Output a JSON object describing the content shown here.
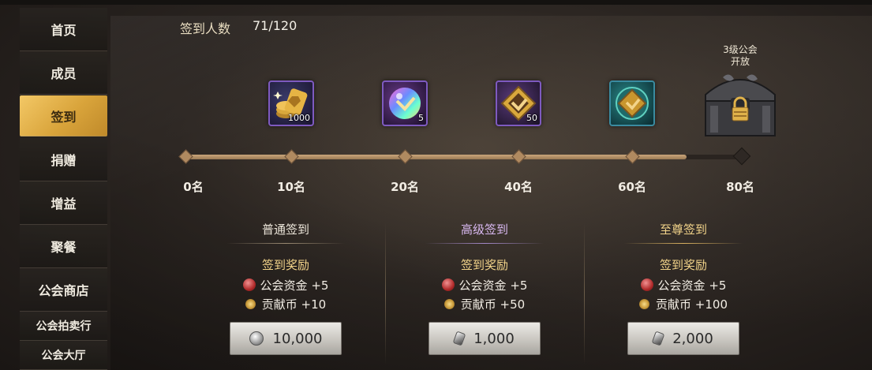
{
  "sidebar": {
    "items": [
      {
        "label": "首页"
      },
      {
        "label": "成员"
      },
      {
        "label": "签到"
      },
      {
        "label": "捐赠"
      },
      {
        "label": "增益"
      },
      {
        "label": "聚餐"
      },
      {
        "label": "公会商店"
      },
      {
        "label": "公会拍卖行"
      },
      {
        "label": "公会大厅"
      }
    ],
    "active_index": 2
  },
  "header": {
    "checkin_label": "签到人数",
    "checkin_count": "71/120"
  },
  "progress": {
    "fill_fraction": 0.9,
    "milestones": [
      {
        "label": "0名"
      },
      {
        "label": "10名",
        "reward_icon": "gold-coins-icon",
        "qty": "1000"
      },
      {
        "label": "20名",
        "reward_icon": "rainbow-orb-icon",
        "qty": "5"
      },
      {
        "label": "40名",
        "reward_icon": "gold-emblem-icon",
        "qty": "50"
      },
      {
        "label": "60名",
        "reward_icon": "teal-emblem-icon",
        "qty": ""
      },
      {
        "label": "80名",
        "reward_icon": "locked-chest-icon"
      }
    ],
    "chest_label_line1": "3级公会",
    "chest_label_line2": "开放"
  },
  "tiers": [
    {
      "title": "普通签到",
      "reward_heading": "签到奖励",
      "rewards": [
        {
          "icon": "guild-fund-icon",
          "text": "公会资金 +5"
        },
        {
          "icon": "contribution-coin-icon",
          "text": "贡献币 +10"
        }
      ],
      "cost": "10,000",
      "cost_icon": "silver-coin-icon"
    },
    {
      "title": "高级签到",
      "reward_heading": "签到奖励",
      "rewards": [
        {
          "icon": "guild-fund-icon",
          "text": "公会资金 +5"
        },
        {
          "icon": "contribution-coin-icon",
          "text": "贡献币 +50"
        }
      ],
      "cost": "1,000",
      "cost_icon": "gem-icon"
    },
    {
      "title": "至尊签到",
      "reward_heading": "签到奖励",
      "rewards": [
        {
          "icon": "guild-fund-icon",
          "text": "公会资金 +5"
        },
        {
          "icon": "contribution-coin-icon",
          "text": "贡献币 +100"
        }
      ],
      "cost": "2,000",
      "cost_icon": "gem-icon"
    }
  ],
  "colors": {
    "active_tab": "#e0ad45",
    "accent_gold": "#f3d48a",
    "advanced_purple": "#d8b8f0"
  }
}
